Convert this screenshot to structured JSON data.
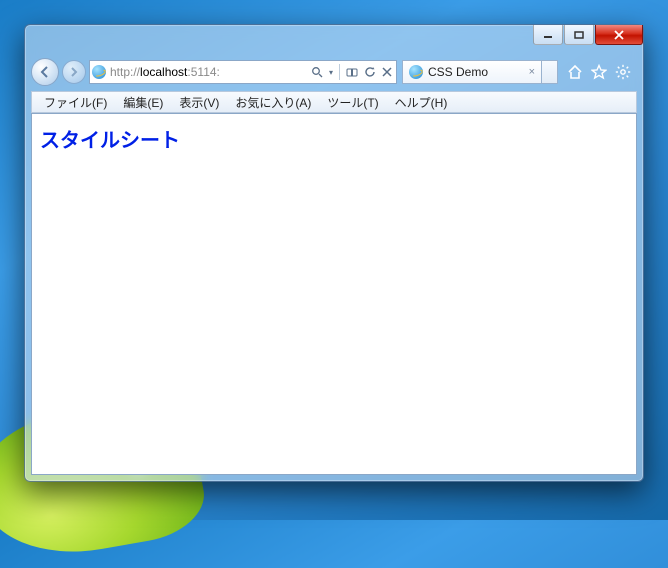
{
  "address": {
    "scheme": "http://",
    "host": "localhost",
    "rest": ":5114:",
    "search_icon": "search-icon",
    "dropdown_icon": "chevron-down-icon",
    "compat_icon": "compat-view-icon",
    "refresh_icon": "refresh-icon",
    "stop_icon": "stop-icon"
  },
  "tab": {
    "title": "CSS Demo",
    "close_label": "×"
  },
  "menubar": {
    "items": [
      {
        "label": "ファイル(F)"
      },
      {
        "label": "編集(E)"
      },
      {
        "label": "表示(V)"
      },
      {
        "label": "お気に入り(A)"
      },
      {
        "label": "ツール(T)"
      },
      {
        "label": "ヘルプ(H)"
      }
    ]
  },
  "page": {
    "heading": "スタイルシート"
  },
  "window": {
    "minimize": "minimize",
    "maximize": "maximize",
    "close": "close"
  },
  "cmd": {
    "home": "home-icon",
    "fav": "star-icon",
    "tools": "gear-icon"
  }
}
